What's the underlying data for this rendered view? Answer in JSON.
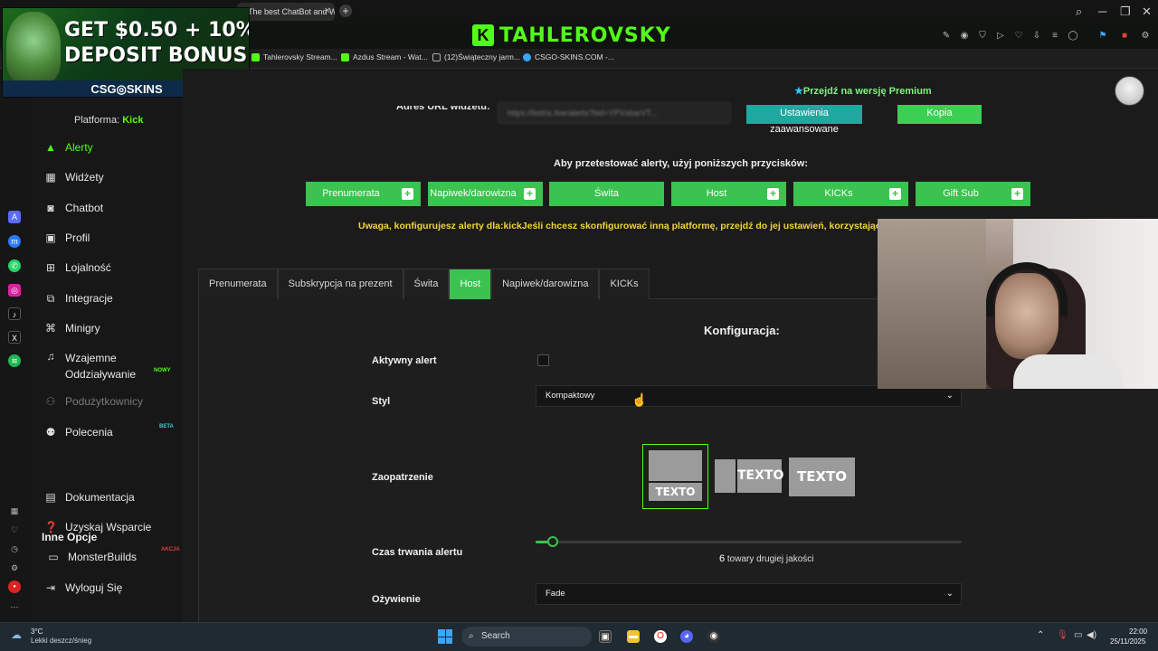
{
  "browser": {
    "tab_title": "The best ChatBot and Wi",
    "brand_letter": "K",
    "brand_name": "TAHLEROVSKY",
    "bookmarks": [
      "Tahlerovsky Stream...",
      "Azdus Stream - Wat...",
      "(12)Świąteczny jarm...",
      "CSGO-SKINS.COM -..."
    ]
  },
  "ad": {
    "line1": "GET $0.50 + 10%",
    "line2": "DEPOSIT BONUS",
    "logo": "CSG◎SKINS"
  },
  "sidebar": {
    "platform_label": "Platforma:",
    "platform_value": "Kick",
    "items": [
      {
        "label": "Alerty",
        "icon": "warning-icon"
      },
      {
        "label": "Widżety",
        "icon": "widgets-icon"
      },
      {
        "label": "Chatbot",
        "icon": "robot-icon"
      },
      {
        "label": "Profil",
        "icon": "profile-icon"
      },
      {
        "label": "Lojalność",
        "icon": "gift-icon"
      },
      {
        "label": "Integracje",
        "icon": "integrations-icon"
      },
      {
        "label": "Minigry",
        "icon": "controller-icon"
      },
      {
        "label": "Wzajemne Oddziaływanie",
        "icon": "music-icon",
        "badge": "NOWY"
      },
      {
        "label": "Podużytkownicy",
        "icon": "users-icon"
      },
      {
        "label": "Polecenia",
        "icon": "referrals-icon",
        "badge": "BETA"
      }
    ],
    "other_title": "Inne Opcje",
    "other_items": [
      {
        "label": "Dokumentacja",
        "icon": "docs-icon"
      },
      {
        "label": "Uzyskaj Wsparcie",
        "icon": "help-icon"
      },
      {
        "label": "MonsterBuilds",
        "icon": "laptop-icon",
        "badge": "AKCJA"
      },
      {
        "label": "Wyloguj Się",
        "icon": "logout-icon"
      }
    ]
  },
  "header": {
    "premium": "Przejdź na wersję Premium",
    "url_label": "Adres URL widżetu:",
    "url_value": "https://botrix.live/alerts?bid=YPVsbarVT...",
    "advanced_button": "Ustawienia zaawansowane",
    "copy_button": "Kopia"
  },
  "test": {
    "title": "Aby przetestować alerty, użyj poniższych przycisków:",
    "buttons": [
      "Prenumerata",
      "Napiwek/darowizna",
      "Świta",
      "Host",
      "KICKs",
      "Gift Sub"
    ],
    "warning_prefix": "Uwaga, konfigurujesz alerty dla:",
    "warning_platform": "kick",
    "warning_suffix": "Jeśli chcesz skonfigurować inną platformę, przejdź do jej ustawień, korzystając"
  },
  "tabs": [
    "Prenumerata",
    "Subskrypcja na prezent",
    "Świta",
    "Host",
    "Napiwek/darowizna",
    "KICKs"
  ],
  "active_tab": "Host",
  "config": {
    "title": "Konfiguracja:",
    "active_label": "Aktywny alert",
    "active_checked": false,
    "style_label": "Styl",
    "style_value": "Kompaktowy",
    "layout_label": "Zaopatrzenie",
    "layout_option_text": "TEXTO",
    "duration_label": "Czas trwania alertu",
    "duration_value": "6",
    "duration_unit": "towary drugiej jakości",
    "duration_fill": 0.04,
    "animation_label": "Ożywienie",
    "animation_value": "Fade"
  },
  "taskbar": {
    "weather_temp": "3°C",
    "weather_desc": "Lekki deszcz/śnieg",
    "search": "Search",
    "time": "22:00",
    "date": "25/11/2025"
  },
  "colors": {
    "accent": "#3bc24f",
    "kick_green": "#53fc18",
    "warning": "#f0d43a",
    "teal": "#1fa7a0"
  }
}
